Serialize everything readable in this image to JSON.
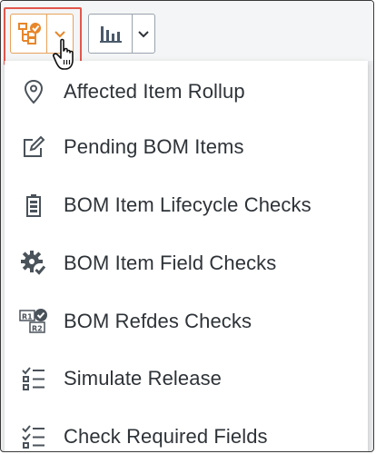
{
  "toolbar": {
    "primary_button_icon": "bom-checks-icon",
    "primary_dropdown_icon": "chevron-down-icon",
    "secondary_button_icon": "bar-chart-icon",
    "secondary_dropdown_icon": "chevron-down-icon",
    "accent_color": "#e8862b",
    "highlight_color": "#e2574c"
  },
  "menu": {
    "items": [
      {
        "label": "Affected Item Rollup",
        "icon": "location-pin-icon"
      },
      {
        "label": "Pending BOM Items",
        "icon": "edit-document-icon"
      },
      {
        "label": "BOM Item Lifecycle Checks",
        "icon": "battery-icon"
      },
      {
        "label": "BOM Item Field Checks",
        "icon": "gear-check-icon"
      },
      {
        "label": "BOM Refdes Checks",
        "icon": "refdes-check-icon"
      },
      {
        "label": "Simulate Release",
        "icon": "checklist-icon"
      },
      {
        "label": "Check Required Fields",
        "icon": "checklist-icon"
      }
    ]
  }
}
